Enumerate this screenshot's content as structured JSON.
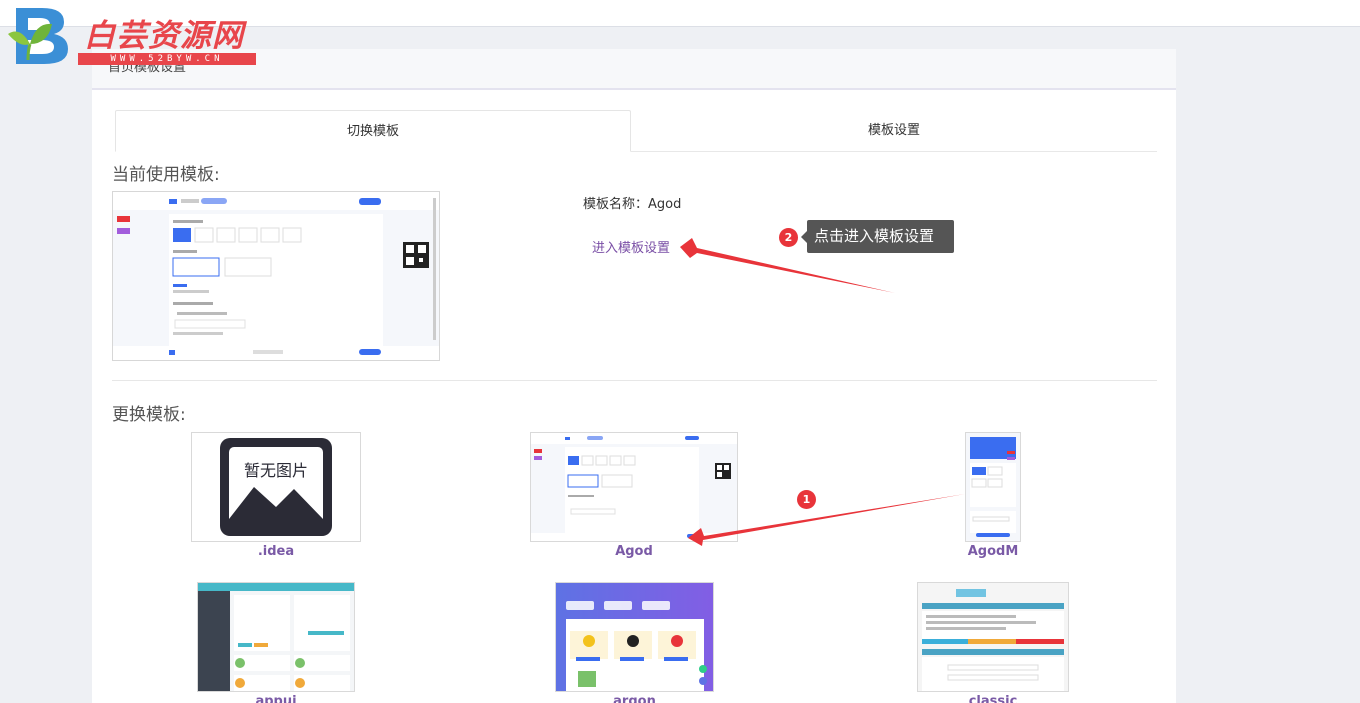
{
  "logo": {
    "brand_text": "白芸资源网",
    "url_text": "WWW.52BYW.CN"
  },
  "panel": {
    "title": "首页模板设置"
  },
  "tabs": [
    {
      "label": "切换模板"
    },
    {
      "label": "模板设置"
    }
  ],
  "current": {
    "section_title": "当前使用模板:",
    "name_text": "模板名称：Agod",
    "enter_link": "进入模板设置"
  },
  "replace": {
    "section_title": "更换模板:",
    "templates": [
      {
        "name": ".idea",
        "placeholder": "暂无图片"
      },
      {
        "name": "Agod"
      },
      {
        "name": "AgodM"
      },
      {
        "name": "appui"
      },
      {
        "name": "argon"
      },
      {
        "name": "classic"
      }
    ]
  },
  "annotations": {
    "step1_number": "1",
    "step2_number": "2",
    "step2_text": "点击进入模板设置",
    "arrow_color": "#e8343a"
  }
}
